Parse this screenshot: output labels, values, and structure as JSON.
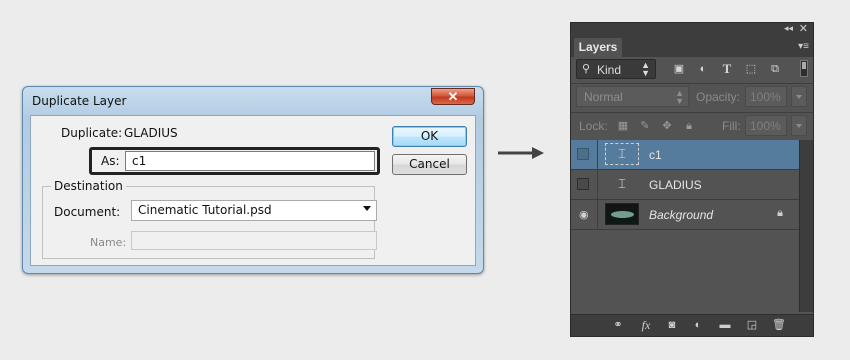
{
  "dialog": {
    "title": "Duplicate Layer",
    "close_label": "✕",
    "duplicate_label": "Duplicate:",
    "duplicate_value": "GLADIUS",
    "as_label": "As:",
    "as_value": "c1",
    "ok_label": "OK",
    "cancel_label": "Cancel",
    "destination_legend": "Destination",
    "document_label": "Document:",
    "document_value": "Cinematic Tutorial.psd",
    "name_label": "Name:",
    "name_value": ""
  },
  "layers_panel": {
    "tab_label": "Layers",
    "filter": {
      "value": "Kind",
      "icon": "search-icon"
    },
    "filter_icons": [
      "image-filter-icon",
      "adjustment-filter-icon",
      "type-filter-icon",
      "shape-filter-icon",
      "smart-object-filter-icon"
    ],
    "blend_mode": "Normal",
    "opacity_label": "Opacity:",
    "opacity_value": "100%",
    "lock_label": "Lock:",
    "lock_icons": [
      "lock-transparent-icon",
      "lock-pixels-icon",
      "lock-position-icon",
      "lock-all-icon"
    ],
    "fill_label": "Fill:",
    "fill_value": "100%",
    "layers": [
      {
        "name": "c1",
        "selected": true,
        "visible": false,
        "thumb": "text-icon",
        "italic": false,
        "locked": false
      },
      {
        "name": "GLADIUS",
        "selected": false,
        "visible": false,
        "thumb": "text-icon",
        "italic": false,
        "locked": false
      },
      {
        "name": "Background",
        "selected": false,
        "visible": true,
        "thumb": "image",
        "italic": true,
        "locked": true
      }
    ],
    "footer_icons": [
      "link-icon",
      "fx-icon",
      "mask-icon",
      "adjustment-icon",
      "folder-icon",
      "new-layer-icon",
      "trash-icon"
    ],
    "fx_label": "fx"
  },
  "colors": {
    "selected_layer": "#557c9c",
    "panel_bg": "#535353",
    "dialog_frame": "#b2cbe2"
  }
}
